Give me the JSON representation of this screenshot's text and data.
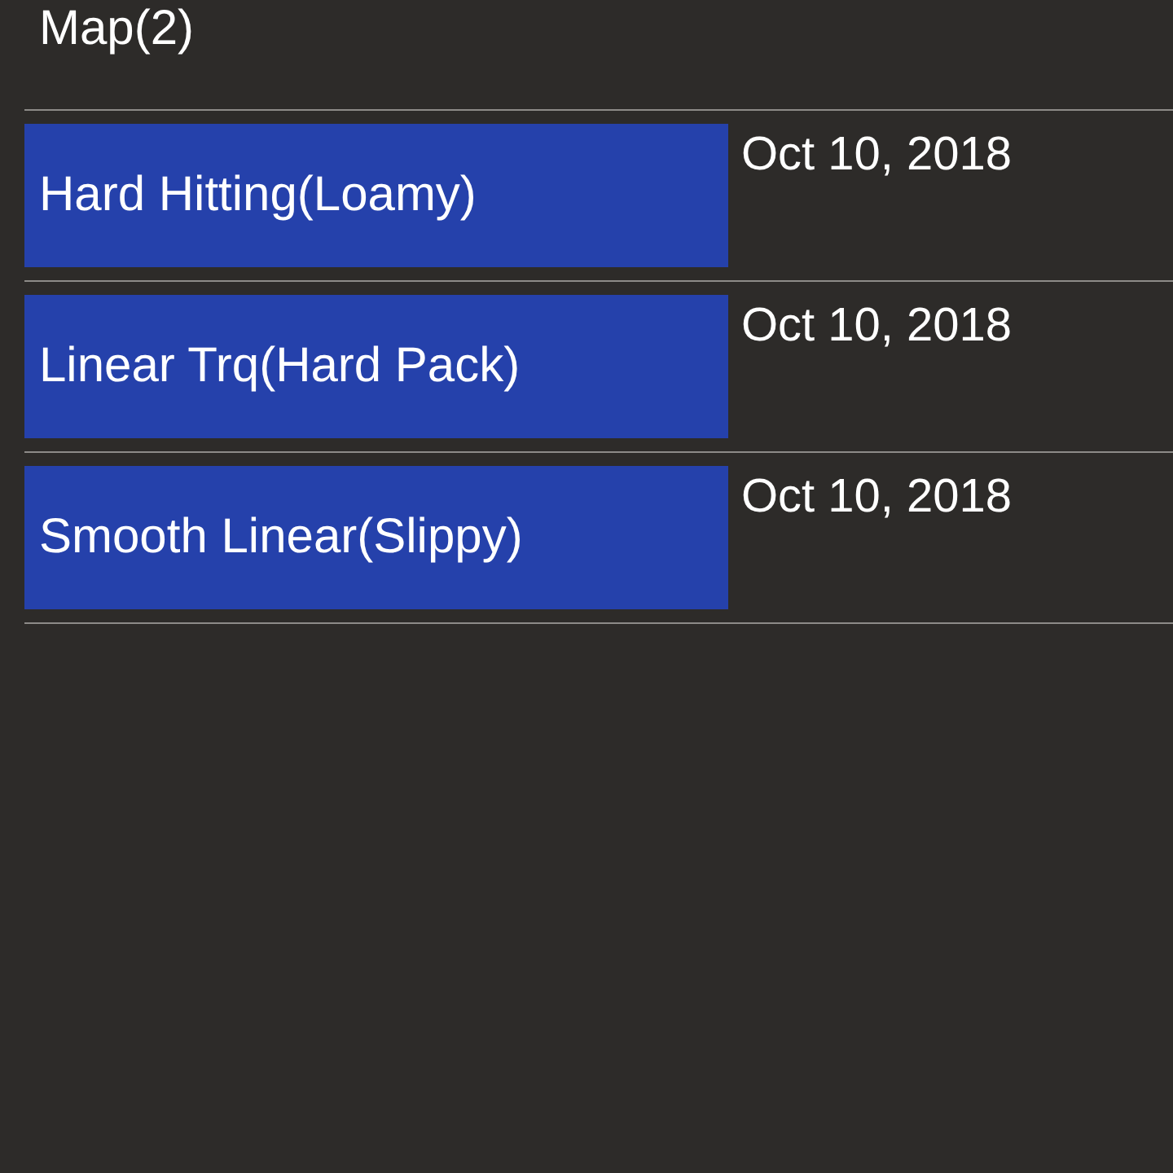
{
  "maps": [
    {
      "name": "Map(2)",
      "highlighted": false
    },
    {
      "name": "Hard Hitting(Loamy)",
      "date": "Oct 10, 2018",
      "highlighted": true
    },
    {
      "name": "Linear Trq(Hard Pack)",
      "date": "Oct 10, 2018",
      "highlighted": true
    },
    {
      "name": "Smooth Linear(Slippy)",
      "date": "Oct 10, 2018",
      "highlighted": true
    }
  ]
}
